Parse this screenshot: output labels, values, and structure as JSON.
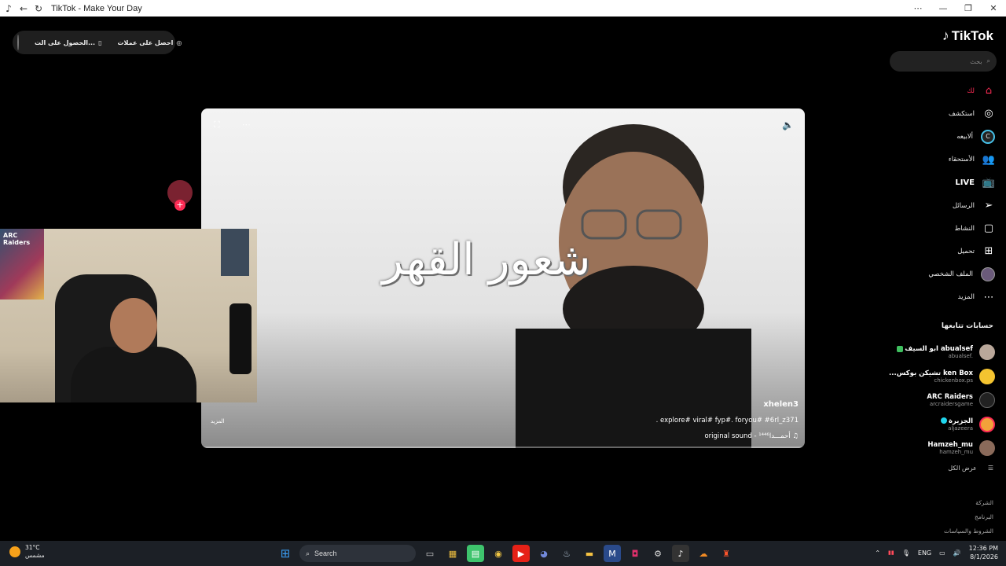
{
  "browser": {
    "title": "TikTok - Make Your Day",
    "minimize": "—",
    "restore": "❐",
    "close": "✕",
    "menu": "⋯"
  },
  "top_pill": {
    "item1": "احصل على عملات",
    "item2": "الحصول على الت..."
  },
  "sidebar": {
    "logo": "TikTok",
    "search_placeholder": "بحث",
    "nav": [
      {
        "label": "لك",
        "icon": "home-icon"
      },
      {
        "label": "استكشف",
        "icon": "compass-icon"
      },
      {
        "label": "ألابيعه",
        "icon": "shop-icon"
      },
      {
        "label": "الأستحقاء",
        "icon": "friends-icon"
      },
      {
        "label": "LIVE",
        "icon": "live-icon"
      },
      {
        "label": "الرسائل",
        "icon": "messages-icon"
      },
      {
        "label": "النشاط",
        "icon": "activity-icon"
      },
      {
        "label": "تحميل",
        "icon": "upload-icon"
      },
      {
        "label": "الملف الشخصي",
        "icon": "profile-icon"
      },
      {
        "label": "المزيد",
        "icon": "more-icon"
      }
    ],
    "following_title": "حسابات تتابعها",
    "accounts": [
      {
        "name": "ابو السيف abualsef",
        "handle": "abualsef."
      },
      {
        "name": "...تشيكن بوكس ken Box",
        "handle": "chickenbox.ps"
      },
      {
        "name": "ARC Raiders",
        "handle": "arcraidersgame"
      },
      {
        "name": "الجزيرة",
        "handle": "aljazeera"
      },
      {
        "name": "Hamzeh_mu",
        "handle": "hamzeh_mu"
      }
    ],
    "see_all": "عرض الكل",
    "footer": [
      "الشركة",
      "البرنامج",
      "الشروط والسياسات"
    ]
  },
  "video": {
    "calligraphy": "شعور القهر",
    "author": "xhelen3",
    "description": ". explore# viral# fyp#. foryou# #6rl_z371",
    "music": "original sound - ¹⁴⁴⁶أحمـــدا",
    "more": "المزيد",
    "progress": 0.0
  },
  "webcam": {
    "poster_text": "ARC Raiders"
  },
  "taskbar": {
    "temp": "31°C",
    "weather": "مشمس",
    "search": "Search",
    "lang": "ENG",
    "time": "12:36 PM",
    "date": "8/1/2026"
  }
}
